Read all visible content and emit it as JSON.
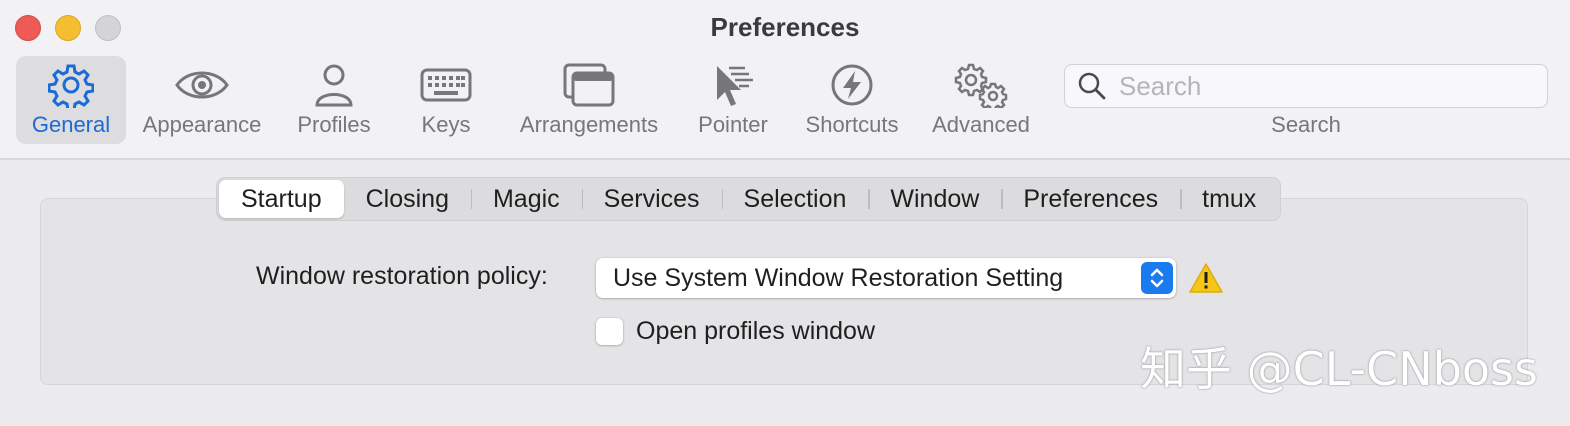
{
  "window": {
    "title": "Preferences"
  },
  "toolbar": {
    "items": [
      {
        "label": "General",
        "icon": "gear-icon",
        "selected": true
      },
      {
        "label": "Appearance",
        "icon": "eye-icon"
      },
      {
        "label": "Profiles",
        "icon": "person-icon"
      },
      {
        "label": "Keys",
        "icon": "keyboard-icon"
      },
      {
        "label": "Arrangements",
        "icon": "windows-icon"
      },
      {
        "label": "Pointer",
        "icon": "pointer-icon"
      },
      {
        "label": "Shortcuts",
        "icon": "bolt-icon"
      },
      {
        "label": "Advanced",
        "icon": "gears-icon"
      }
    ],
    "search": {
      "placeholder": "Search",
      "caption": "Search"
    }
  },
  "tabs": {
    "items": [
      "Startup",
      "Closing",
      "Magic",
      "Services",
      "Selection",
      "Window",
      "Preferences",
      "tmux"
    ],
    "active": "Startup"
  },
  "startup": {
    "restoration_label": "Window restoration policy:",
    "restoration_value": "Use System Window Restoration Setting",
    "open_profiles_label": "Open profiles window",
    "open_profiles_checked": false
  },
  "watermark": "知乎 @CL-CNboss",
  "colors": {
    "accent": "#1b6ad6",
    "close": "#ee5b56",
    "minimize": "#f5be30",
    "warning": "#f5c518"
  }
}
